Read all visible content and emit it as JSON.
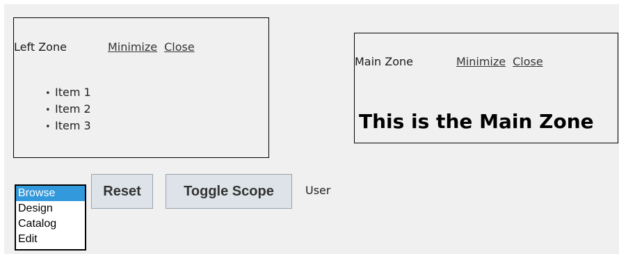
{
  "left_zone": {
    "title": "Left Zone",
    "minimize_label": "Minimize",
    "close_label": "Close",
    "items": [
      "Item 1",
      "Item 2",
      "Item 3"
    ]
  },
  "main_zone": {
    "title": "Main Zone",
    "minimize_label": "Minimize",
    "close_label": "Close",
    "heading": "This is the Main Zone"
  },
  "display_mode": {
    "options": [
      "Browse",
      "Design",
      "Catalog",
      "Edit"
    ],
    "selected": "Browse"
  },
  "buttons": {
    "reset_label": "Reset",
    "toggle_scope_label": "Toggle Scope"
  },
  "scope_label": "User",
  "colors": {
    "page_background": "#f0f0f0",
    "selected_option": "#3399dd",
    "button_background": "#dde3e8"
  }
}
